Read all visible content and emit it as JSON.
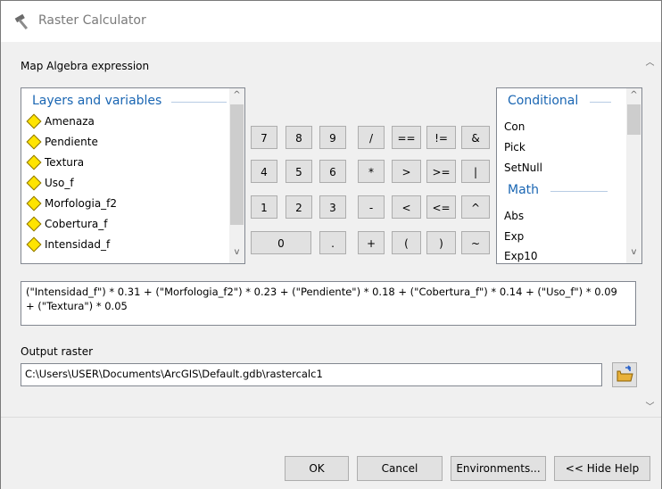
{
  "window": {
    "title": "Raster Calculator"
  },
  "section": {
    "expression_label": "Map Algebra expression",
    "output_label": "Output raster"
  },
  "layers": {
    "header": "Layers and variables",
    "items": [
      "Amenaza",
      "Pendiente",
      "Textura",
      "Uso_f",
      "Morfologia_f2",
      "Cobertura_f",
      "Intensidad_f"
    ]
  },
  "keypad": [
    [
      "7",
      "8",
      "9",
      "/",
      "==",
      "!=",
      "&"
    ],
    [
      "4",
      "5",
      "6",
      "*",
      ">",
      ">=",
      "|"
    ],
    [
      "1",
      "2",
      "3",
      "-",
      "<",
      "<=",
      "^"
    ],
    [
      "0",
      ".",
      "+",
      "(",
      ")",
      "~"
    ]
  ],
  "functions": {
    "header_conditional": "Conditional",
    "conditional": [
      "Con",
      "Pick",
      "SetNull"
    ],
    "header_math": "Math",
    "math": [
      "Abs",
      "Exp",
      "Exp10"
    ]
  },
  "expression": "(\"Intensidad_f\") * 0.31 + (\"Morfologia_f2\") * 0.23 + (\"Pendiente\") * 0.18 + (\"Cobertura_f\") * 0.14 + (\"Uso_f\") * 0.09 + (\"Textura\") * 0.05",
  "output_raster": "C:\\Users\\USER\\Documents\\ArcGIS\\Default.gdb\\rastercalc1",
  "buttons": {
    "ok": "OK",
    "cancel": "Cancel",
    "environments": "Environments...",
    "hide_help": "<< Hide Help"
  },
  "icons": {
    "app": "hammer-icon",
    "browse": "open-folder-icon"
  }
}
